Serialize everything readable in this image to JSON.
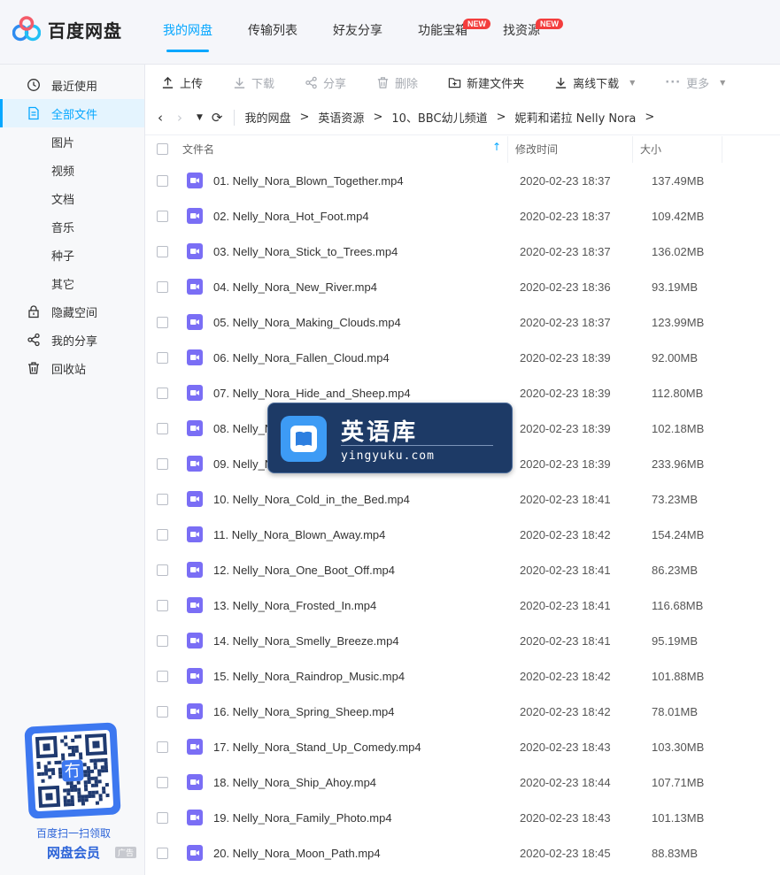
{
  "app": {
    "logo_text": "百度网盘"
  },
  "nav": [
    {
      "label": "我的网盘",
      "active": true,
      "badge": ""
    },
    {
      "label": "传输列表",
      "active": false,
      "badge": ""
    },
    {
      "label": "好友分享",
      "active": false,
      "badge": ""
    },
    {
      "label": "功能宝箱",
      "active": false,
      "badge": "NEW"
    },
    {
      "label": "找资源",
      "active": false,
      "badge": "NEW"
    }
  ],
  "sidebar": {
    "items": [
      {
        "label": "最近使用",
        "icon": "clock-icon",
        "sub": false,
        "active": false
      },
      {
        "label": "全部文件",
        "icon": "document-icon",
        "sub": false,
        "active": true
      },
      {
        "label": "图片",
        "icon": "",
        "sub": true,
        "active": false
      },
      {
        "label": "视频",
        "icon": "",
        "sub": true,
        "active": false
      },
      {
        "label": "文档",
        "icon": "",
        "sub": true,
        "active": false
      },
      {
        "label": "音乐",
        "icon": "",
        "sub": true,
        "active": false
      },
      {
        "label": "种子",
        "icon": "",
        "sub": true,
        "active": false
      },
      {
        "label": "其它",
        "icon": "",
        "sub": true,
        "active": false
      },
      {
        "label": "隐藏空间",
        "icon": "lock-icon",
        "sub": false,
        "active": false
      },
      {
        "label": "我的分享",
        "icon": "share-icon",
        "sub": false,
        "active": false
      },
      {
        "label": "回收站",
        "icon": "trash-icon",
        "sub": false,
        "active": false
      }
    ],
    "promo": {
      "line1": "百度扫一扫领取",
      "line2": "网盘会员",
      "ad": "广告",
      "qr_center": "冇"
    }
  },
  "toolbar": {
    "upload": "上传",
    "download": "下载",
    "share": "分享",
    "delete": "删除",
    "new_folder": "新建文件夹",
    "offline_download": "离线下载",
    "more": "更多"
  },
  "breadcrumb": [
    "我的网盘",
    "英语资源",
    "10、BBC幼儿频道",
    "妮莉和诺拉 Nelly Nora"
  ],
  "table": {
    "col_name": "文件名",
    "col_time": "修改时间",
    "col_size": "大小",
    "rows": [
      {
        "name": "01. Nelly_Nora_Blown_Together.mp4",
        "time": "2020-02-23 18:37",
        "size": "137.49MB"
      },
      {
        "name": "02. Nelly_Nora_Hot_Foot.mp4",
        "time": "2020-02-23 18:37",
        "size": "109.42MB"
      },
      {
        "name": "03. Nelly_Nora_Stick_to_Trees.mp4",
        "time": "2020-02-23 18:37",
        "size": "136.02MB"
      },
      {
        "name": "04. Nelly_Nora_New_River.mp4",
        "time": "2020-02-23 18:36",
        "size": "93.19MB"
      },
      {
        "name": "05. Nelly_Nora_Making_Clouds.mp4",
        "time": "2020-02-23 18:37",
        "size": "123.99MB"
      },
      {
        "name": "06. Nelly_Nora_Fallen_Cloud.mp4",
        "time": "2020-02-23 18:39",
        "size": "92.00MB"
      },
      {
        "name": "07. Nelly_Nora_Hide_and_Sheep.mp4",
        "time": "2020-02-23 18:39",
        "size": "112.80MB"
      },
      {
        "name": "08. Nelly_No",
        "time": "2020-02-23 18:39",
        "size": "102.18MB"
      },
      {
        "name": "09. Nelly_No",
        "time": "2020-02-23 18:39",
        "size": "233.96MB"
      },
      {
        "name": "10. Nelly_Nora_Cold_in_the_Bed.mp4",
        "time": "2020-02-23 18:41",
        "size": "73.23MB"
      },
      {
        "name": "11. Nelly_Nora_Blown_Away.mp4",
        "time": "2020-02-23 18:42",
        "size": "154.24MB"
      },
      {
        "name": "12. Nelly_Nora_One_Boot_Off.mp4",
        "time": "2020-02-23 18:41",
        "size": "86.23MB"
      },
      {
        "name": "13. Nelly_Nora_Frosted_In.mp4",
        "time": "2020-02-23 18:41",
        "size": "116.68MB"
      },
      {
        "name": "14. Nelly_Nora_Smelly_Breeze.mp4",
        "time": "2020-02-23 18:41",
        "size": "95.19MB"
      },
      {
        "name": "15. Nelly_Nora_Raindrop_Music.mp4",
        "time": "2020-02-23 18:42",
        "size": "101.88MB"
      },
      {
        "name": "16. Nelly_Nora_Spring_Sheep.mp4",
        "time": "2020-02-23 18:42",
        "size": "78.01MB"
      },
      {
        "name": "17. Nelly_Nora_Stand_Up_Comedy.mp4",
        "time": "2020-02-23 18:43",
        "size": "103.30MB"
      },
      {
        "name": "18. Nelly_Nora_Ship_Ahoy.mp4",
        "time": "2020-02-23 18:44",
        "size": "107.71MB"
      },
      {
        "name": "19. Nelly_Nora_Family_Photo.mp4",
        "time": "2020-02-23 18:43",
        "size": "101.13MB"
      },
      {
        "name": "20. Nelly_Nora_Moon_Path.mp4",
        "time": "2020-02-23 18:45",
        "size": "88.83MB"
      }
    ]
  },
  "watermark": {
    "title": "英语库",
    "subtitle": "yingyuku.com"
  },
  "colors": {
    "accent": "#06a7ff",
    "video_icon": "#7a6ef5",
    "badge": "#f33d3d"
  }
}
